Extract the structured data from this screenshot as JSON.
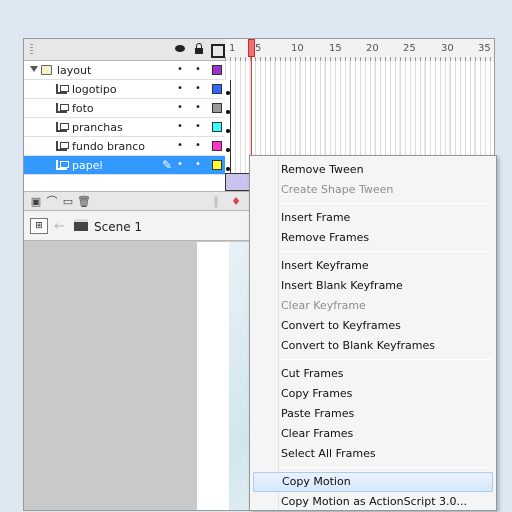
{
  "timeline": {
    "header_icons": [
      "eye-icon",
      "lock-icon",
      "outline-icon"
    ],
    "ruler_ticks": [
      "1",
      "5",
      "10",
      "15",
      "20",
      "25",
      "30",
      "35"
    ],
    "layers": [
      {
        "name": "layout",
        "type": "folder",
        "color": "#9933cc"
      },
      {
        "name": "logotipo",
        "type": "layer",
        "color": "#3366ff"
      },
      {
        "name": "foto",
        "type": "layer",
        "color": "#999999"
      },
      {
        "name": "pranchas",
        "type": "layer",
        "color": "#33ffff"
      },
      {
        "name": "fundo branco",
        "type": "layer",
        "color": "#ff33cc"
      },
      {
        "name": "papel",
        "type": "layer",
        "color": "#ffff33",
        "selected": true
      }
    ],
    "footer_icons": [
      "new-layer-icon",
      "motion-guide-icon",
      "new-folder-icon",
      "delete-layer-icon"
    ]
  },
  "scenebar": {
    "scene_label": "Scene 1"
  },
  "context_menu": {
    "items": [
      {
        "label": "Remove Tween",
        "enabled": true
      },
      {
        "label": "Create Shape Tween",
        "enabled": false
      },
      {
        "separator": true
      },
      {
        "label": "Insert Frame",
        "enabled": true
      },
      {
        "label": "Remove Frames",
        "enabled": true
      },
      {
        "separator": true
      },
      {
        "label": "Insert Keyframe",
        "enabled": true
      },
      {
        "label": "Insert Blank Keyframe",
        "enabled": true
      },
      {
        "label": "Clear Keyframe",
        "enabled": false
      },
      {
        "label": "Convert to Keyframes",
        "enabled": true
      },
      {
        "label": "Convert to Blank Keyframes",
        "enabled": true
      },
      {
        "separator": true
      },
      {
        "label": "Cut Frames",
        "enabled": true
      },
      {
        "label": "Copy Frames",
        "enabled": true
      },
      {
        "label": "Paste Frames",
        "enabled": true
      },
      {
        "label": "Clear Frames",
        "enabled": true
      },
      {
        "label": "Select All Frames",
        "enabled": true
      },
      {
        "separator": true
      },
      {
        "label": "Copy Motion",
        "enabled": true,
        "highlighted": true
      },
      {
        "label": "Copy Motion as ActionScript 3.0...",
        "enabled": true
      }
    ]
  },
  "colors": {
    "selection": "#3399ff",
    "playhead": "#e04040",
    "tween": "#c9c3ef"
  }
}
